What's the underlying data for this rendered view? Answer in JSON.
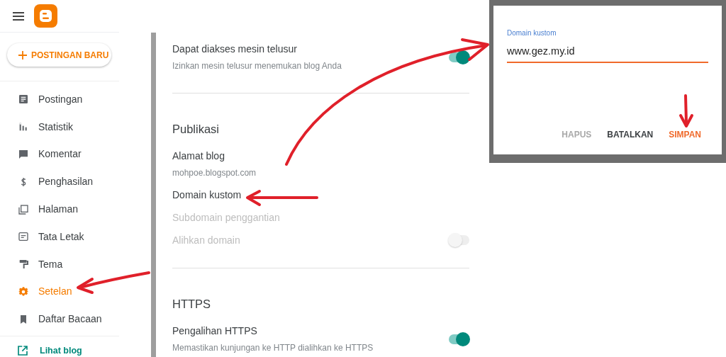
{
  "sidebar": {
    "new_post_button": {
      "label": "POSTINGAN BARU"
    },
    "items": [
      {
        "label": "Postingan",
        "selected": false
      },
      {
        "label": "Statistik",
        "selected": false
      },
      {
        "label": "Komentar",
        "selected": false
      },
      {
        "label": "Penghasilan",
        "selected": false
      },
      {
        "label": "Halaman",
        "selected": false
      },
      {
        "label": "Tata Letak",
        "selected": false
      },
      {
        "label": "Tema",
        "selected": false
      },
      {
        "label": "Setelan",
        "selected": true
      },
      {
        "label": "Daftar Bacaan",
        "selected": false
      }
    ],
    "footer_link": {
      "label": "Lihat blog"
    }
  },
  "settings": {
    "sections": [
      {
        "items": [
          {
            "label": "Dapat diakses mesin telusur",
            "description": "Izinkan mesin telusur menemukan blog Anda",
            "disabled": false,
            "toggle": {
              "on": true
            }
          }
        ]
      },
      {
        "title": "Publikasi",
        "items": [
          {
            "label": "Alamat blog",
            "description": "mohpoe.blogspot.com",
            "disabled": false
          },
          {
            "label": "Domain kustom",
            "disabled": false
          },
          {
            "label": "Subdomain penggantian",
            "disabled": true
          },
          {
            "label": "Alihkan domain",
            "disabled": true,
            "toggle": {
              "on": false
            }
          }
        ]
      },
      {
        "title": "HTTPS",
        "items": [
          {
            "label": "Pengalihan HTTPS",
            "description": "Memastikan kunjungan ke HTTP dialihkan ke HTTPS",
            "disabled": false,
            "toggle": {
              "on": true
            }
          }
        ]
      }
    ]
  },
  "dialog": {
    "field_label": "Domain kustom",
    "value": "www.gez.my.id",
    "buttons": [
      {
        "label": "HAPUS",
        "kind": "text",
        "disabled": true
      },
      {
        "label": "BATALKAN",
        "kind": "text",
        "disabled": false
      },
      {
        "label": "SIMPAN",
        "kind": "primary",
        "disabled": false
      }
    ]
  }
}
